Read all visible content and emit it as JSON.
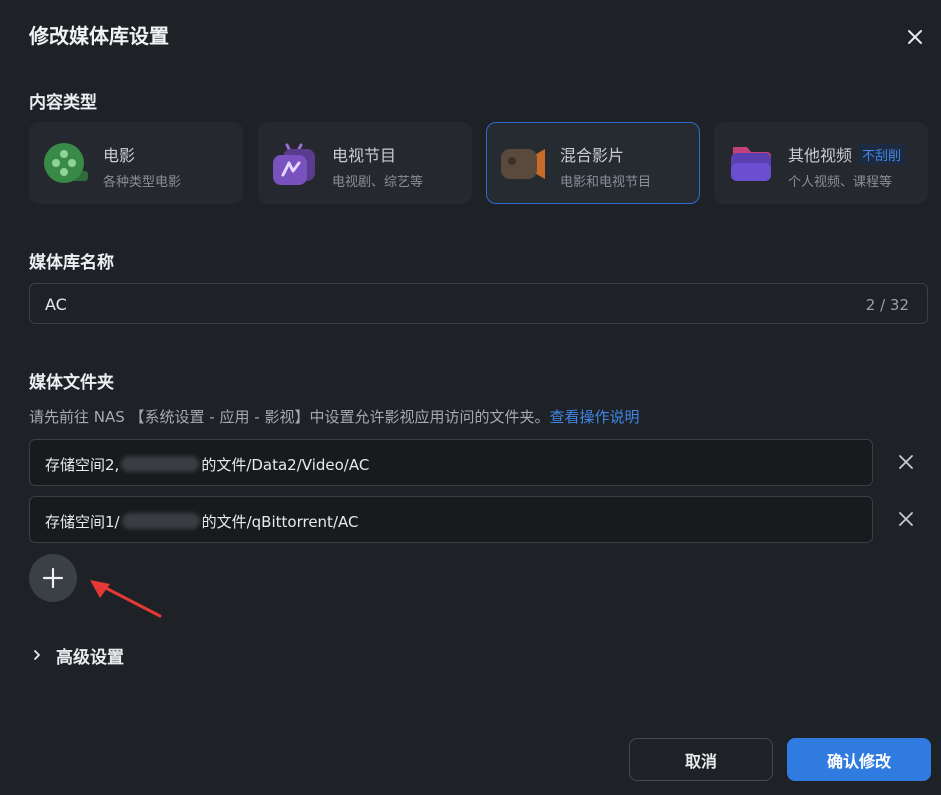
{
  "dialog": {
    "title": "修改媒体库设置"
  },
  "content_type": {
    "label": "内容类型",
    "options": [
      {
        "title": "电影",
        "subtitle": "各种类型电影",
        "icon": "film-reel-icon",
        "selected": false
      },
      {
        "title": "电视节目",
        "subtitle": "电视剧、综艺等",
        "icon": "tv-icon",
        "selected": false
      },
      {
        "title": "混合影片",
        "subtitle": "电影和电视节目",
        "icon": "video-camera-icon",
        "selected": true
      },
      {
        "title": "其他视频",
        "subtitle": "个人视频、课程等",
        "icon": "folder-icon",
        "badge": "不刮削",
        "selected": false
      }
    ]
  },
  "library_name": {
    "label": "媒体库名称",
    "value": "AC",
    "counter": "2 / 32"
  },
  "media_folders": {
    "label": "媒体文件夹",
    "hint": "请先前往 NAS 【系统设置 - 应用 - 影视】中设置允许影视应用访问的文件夹。",
    "hint_link": "查看操作说明",
    "folders": [
      {
        "prefix": "存储空间2,",
        "suffix": "的文件/Data2/Video/AC"
      },
      {
        "prefix": "存储空间1/",
        "suffix": "的文件/qBittorrent/AC"
      }
    ]
  },
  "advanced": {
    "label": "高级设置"
  },
  "actions": {
    "cancel": "取消",
    "confirm": "确认修改"
  },
  "colors": {
    "background": "#1e2126",
    "accent": "#2f7be0",
    "link": "#3f86e8",
    "annotation_arrow": "#e53935"
  }
}
